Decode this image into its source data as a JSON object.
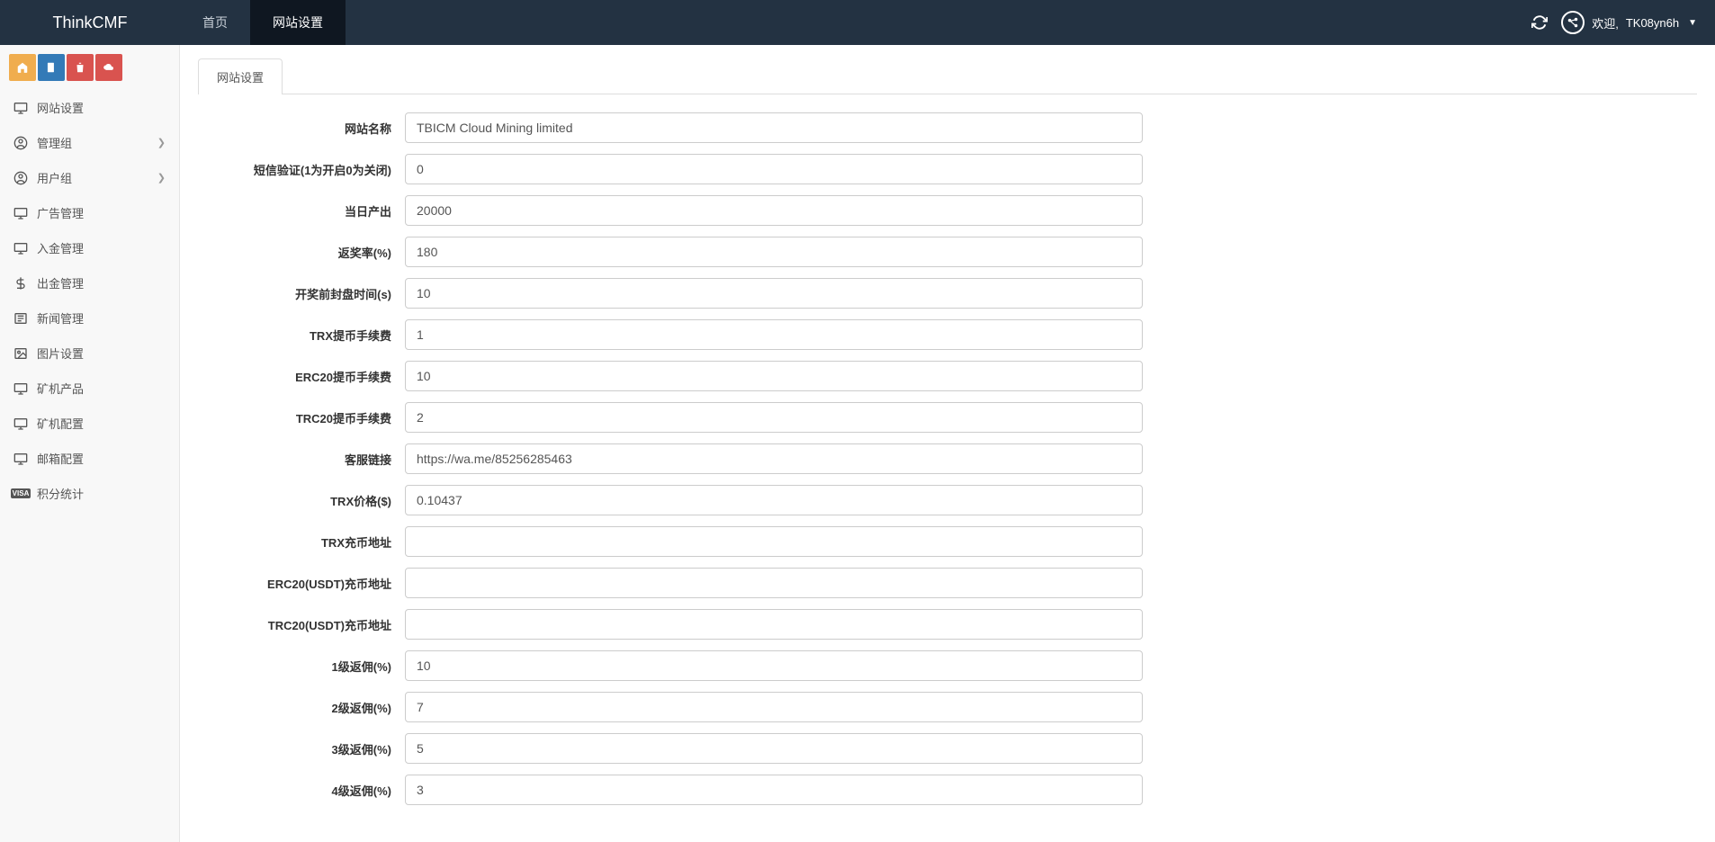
{
  "brand": "ThinkCMF",
  "topnav": {
    "home": "首页",
    "settings": "网站设置"
  },
  "user": {
    "greeting": "欢迎,",
    "name": "TK08yn6h"
  },
  "sidebar": {
    "items": [
      {
        "icon": "monitor",
        "label": "网站设置"
      },
      {
        "icon": "user-circle",
        "label": "管理组",
        "expandable": true
      },
      {
        "icon": "user-circle",
        "label": "用户组",
        "expandable": true
      },
      {
        "icon": "monitor",
        "label": "广告管理"
      },
      {
        "icon": "monitor",
        "label": "入金管理"
      },
      {
        "icon": "dollar",
        "label": "出金管理"
      },
      {
        "icon": "news",
        "label": "新闻管理"
      },
      {
        "icon": "image",
        "label": "图片设置"
      },
      {
        "icon": "monitor",
        "label": "矿机产品"
      },
      {
        "icon": "monitor",
        "label": "矿机配置"
      },
      {
        "icon": "monitor",
        "label": "邮箱配置"
      },
      {
        "icon": "visa",
        "label": "积分统计"
      }
    ]
  },
  "tab_label": "网站设置",
  "form": [
    {
      "label": "网站名称",
      "value": "TBICM Cloud Mining limited"
    },
    {
      "label": "短信验证(1为开启0为关闭)",
      "value": "0"
    },
    {
      "label": "当日产出",
      "value": "20000"
    },
    {
      "label": "返奖率(%)",
      "value": "180"
    },
    {
      "label": "开奖前封盘时间(s)",
      "value": "10"
    },
    {
      "label": "TRX提币手续费",
      "value": "1"
    },
    {
      "label": "ERC20提币手续费",
      "value": "10"
    },
    {
      "label": "TRC20提币手续费",
      "value": "2"
    },
    {
      "label": "客服链接",
      "value": "https://wa.me/85256285463"
    },
    {
      "label": "TRX价格($)",
      "value": "0.10437"
    },
    {
      "label": "TRX充币地址",
      "value": ""
    },
    {
      "label": "ERC20(USDT)充币地址",
      "value": ""
    },
    {
      "label": "TRC20(USDT)充币地址",
      "value": ""
    },
    {
      "label": "1级返佣(%)",
      "value": "10"
    },
    {
      "label": "2级返佣(%)",
      "value": "7"
    },
    {
      "label": "3级返佣(%)",
      "value": "5"
    },
    {
      "label": "4级返佣(%)",
      "value": "3"
    }
  ]
}
